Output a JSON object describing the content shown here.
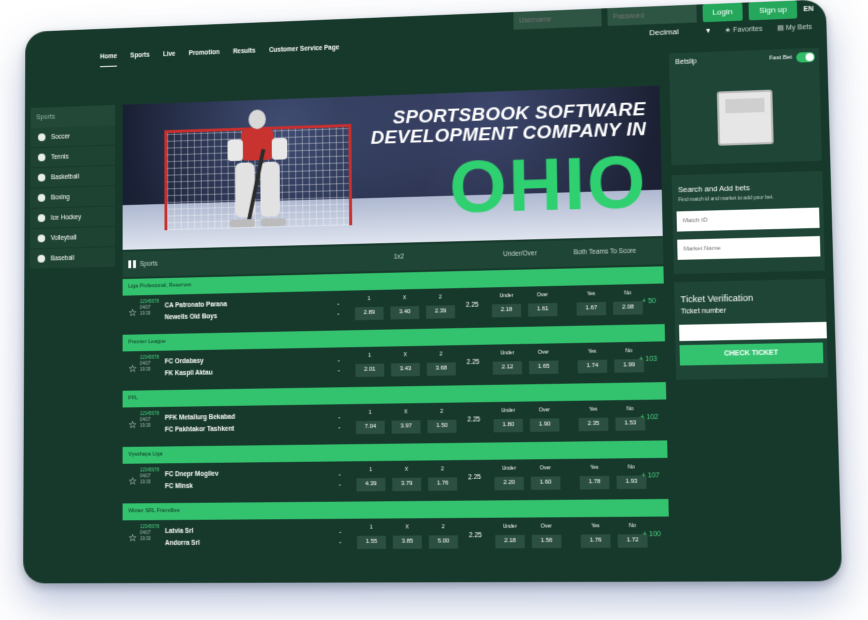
{
  "auth": {
    "username_placeholder": "Username",
    "password_placeholder": "Password",
    "login_label": "Login",
    "signup_label": "Sign up",
    "language": "EN"
  },
  "nav": {
    "items": [
      "Home",
      "Sports",
      "Live",
      "Promotion",
      "Results",
      "Customer Service Page"
    ],
    "odds_format": "Decimal",
    "favorites": "Favorites",
    "my_bets": "My Bets"
  },
  "sidebar": {
    "header": "Sports",
    "items": [
      "Soccer",
      "Tennis",
      "Basketball",
      "Boxing",
      "Ice Hockey",
      "Volleyball",
      "Baseball"
    ]
  },
  "banner": {
    "line1": "SPORTSBOOK SOFTWARE",
    "line2": "DEVELOPMENT COMPANY IN",
    "big": "OHIO"
  },
  "table": {
    "sports_label": "Sports",
    "col_1x2": "1x2",
    "col_uo": "Under/Over",
    "col_bts": "Both Teams To Score",
    "label_1": "1",
    "label_x": "X",
    "label_2": "2",
    "label_under": "Under",
    "label_over": "Over",
    "label_yes": "Yes",
    "label_no": "No",
    "dash": "-"
  },
  "matches": [
    {
      "league": "Liga Profesional, Reserves",
      "id": "12345678",
      "date": "04/07",
      "time": "19:30",
      "home": "CA Patronato Parana",
      "away": "Newells Old Boys",
      "o1": "2.89",
      "ox": "3.40",
      "o2": "2.39",
      "total": "2.25",
      "under": "2.18",
      "over": "1.61",
      "yes": "1.67",
      "no": "2.08",
      "more": "+ 50"
    },
    {
      "league": "Premier League",
      "id": "12345678",
      "date": "04/07",
      "time": "19:30",
      "home": "FC Ordabasy",
      "away": "FK Kaspil Aktau",
      "o1": "2.01",
      "ox": "3.43",
      "o2": "3.68",
      "total": "2.25",
      "under": "2.12",
      "over": "1.65",
      "yes": "1.74",
      "no": "1.99",
      "more": "+ 103"
    },
    {
      "league": "PFL",
      "id": "12345678",
      "date": "04/07",
      "time": "19:30",
      "home": "PFK Metallurg Bekabad",
      "away": "FC Pakhtakor Tashkent",
      "o1": "7.04",
      "ox": "3.97",
      "o2": "1.50",
      "total": "2.25",
      "under": "1.80",
      "over": "1.90",
      "yes": "2.35",
      "no": "1.53",
      "more": "+ 102"
    },
    {
      "league": "Vysshaya Liga",
      "id": "12345678",
      "date": "04/07",
      "time": "19:30",
      "home": "FC Dnepr Mogilev",
      "away": "FC Minsk",
      "o1": "4.39",
      "ox": "3.79",
      "o2": "1.76",
      "total": "2.25",
      "under": "2.20",
      "over": "1.60",
      "yes": "1.78",
      "no": "1.93",
      "more": "+ 107"
    },
    {
      "league": "Winter SRL Friendlies",
      "id": "12345678",
      "date": "04/07",
      "time": "19:30",
      "home": "Latvia Srl",
      "away": "Andorra Srl",
      "o1": "1.55",
      "ox": "3.85",
      "o2": "5.00",
      "total": "2.25",
      "under": "2.18",
      "over": "1.56",
      "yes": "1.76",
      "no": "1.72",
      "more": "+ 100"
    }
  ],
  "betslip": {
    "title": "Betslip",
    "fast_bet": "Fast Bet"
  },
  "add_bets": {
    "title": "Search and Add bets",
    "subtitle": "Find match id and market to add your bet.",
    "match_id_placeholder": "Match ID",
    "market_placeholder": "Market Name"
  },
  "ticket": {
    "title": "Ticket Verification",
    "number_label": "Ticket number",
    "button": "CHECK TICKET"
  },
  "colors": {
    "background": "#17392b",
    "accent": "#33c36f",
    "panel": "#1e4535"
  }
}
